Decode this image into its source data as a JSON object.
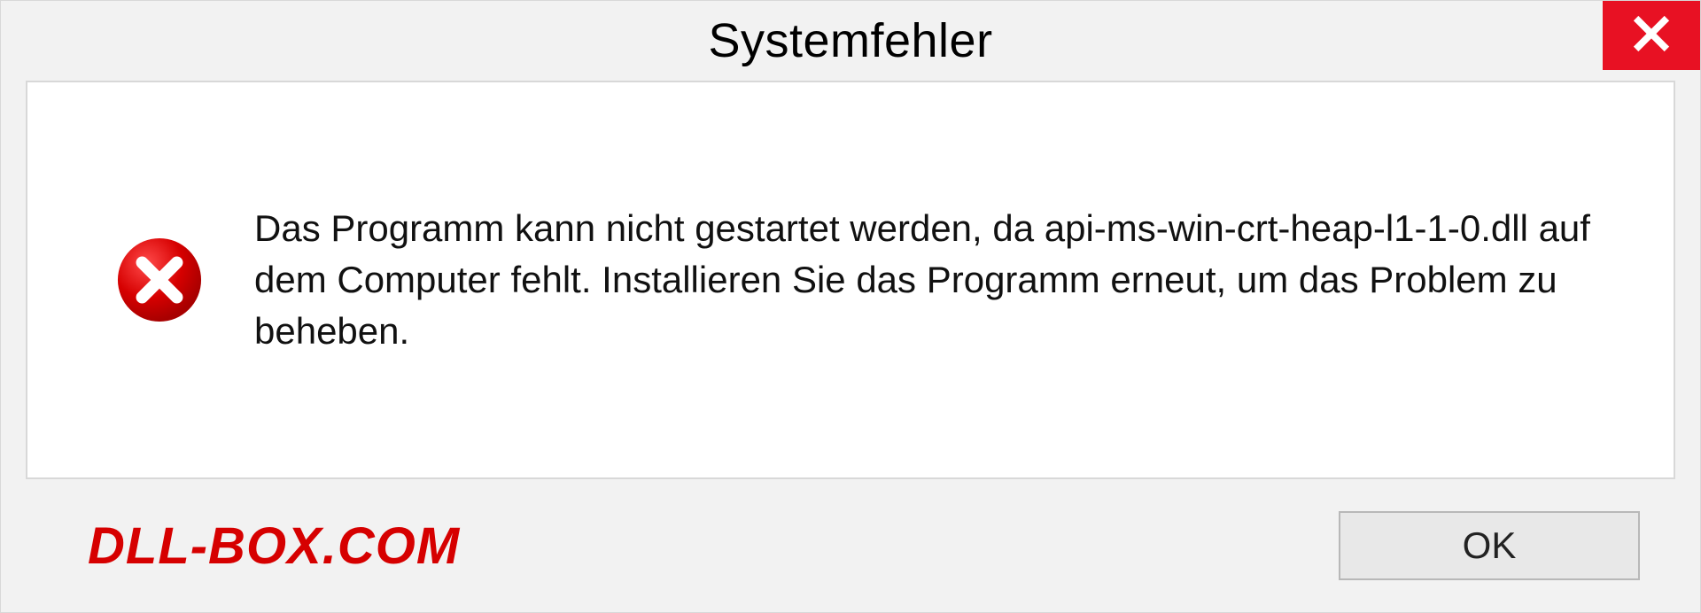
{
  "titlebar": {
    "title": "Systemfehler"
  },
  "message": {
    "text": "Das Programm kann nicht gestartet werden, da api-ms-win-crt-heap-l1-1-0.dll auf dem Computer fehlt. Installieren Sie das Programm erneut, um das Problem zu beheben."
  },
  "footer": {
    "watermark": "DLL-BOX.COM",
    "ok_label": "OK"
  },
  "colors": {
    "close_button": "#e81123",
    "error_icon": "#d60000",
    "watermark": "#d60000"
  }
}
